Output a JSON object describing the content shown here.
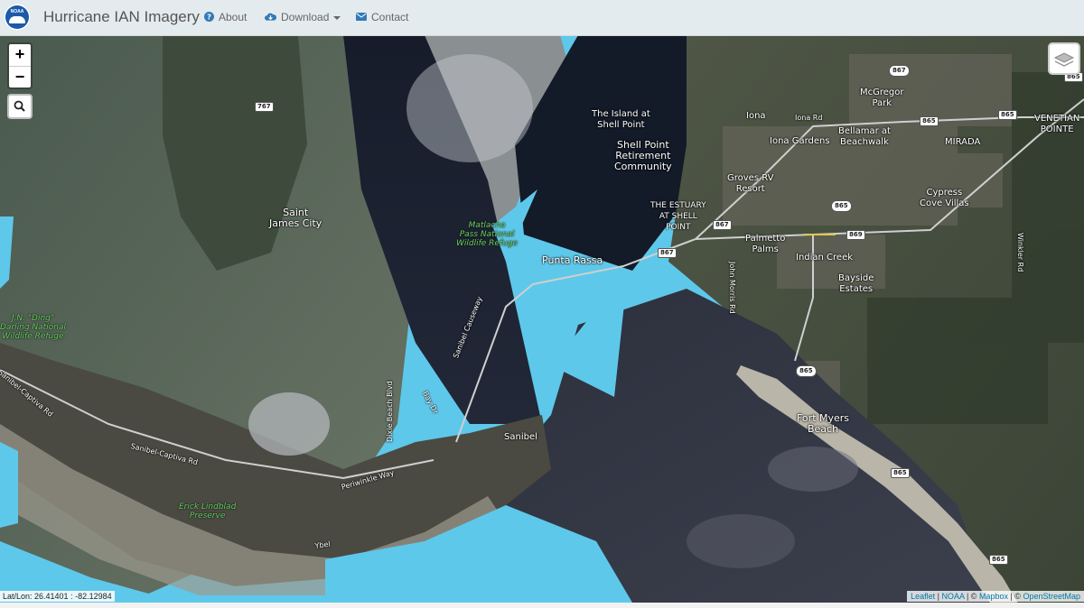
{
  "header": {
    "title": "Hurricane IAN Imagery",
    "logo_text": "NOAA",
    "nav": [
      {
        "label": "About",
        "icon": "question-circle-icon"
      },
      {
        "label": "Download",
        "icon": "cloud-download-icon"
      },
      {
        "label": "Contact",
        "icon": "envelope-icon"
      }
    ]
  },
  "controls": {
    "zoom_in": "+",
    "zoom_out": "−",
    "search_icon": "magnifier-icon",
    "layers_icon": "stacked-layers-icon"
  },
  "status": {
    "latlon": "Lat/Lon: 26.41401 : -82.12984"
  },
  "attribution": {
    "leaflet": "Leaflet",
    "sep1": " | ",
    "noaa": "NOAA",
    "sep2": " | © ",
    "mapbox": "Mapbox",
    "sep3": " | © ",
    "osm": "OpenStreetMap"
  },
  "map": {
    "water_color": "#5ec8ea",
    "places": {
      "saint_james": "Saint\nJames City",
      "punta_rassa": "Punta Rassa",
      "island_shell": "The Island at\nShell Point",
      "shell_retirement": "Shell Point\nRetirement\nCommunity",
      "estuary": "THE ESTUARY\nAT SHELL\nPOINT",
      "iona": "Iona",
      "iona_rd": "Iona Rd",
      "iona_gardens": "Iona Gardens",
      "mcgregor": "McGregor\nPark",
      "bellamar": "Bellamar at\nBeachwalk",
      "miraida": "MIRADA",
      "venetian": "VENETIAN\nPOINTE",
      "groves": "Groves RV\nResort",
      "cypress": "Cypress\nCove Villas",
      "palmetto": "Palmetto\nPalms",
      "indian_creek": "Indian Creek",
      "bayside": "Bayside\nEstates",
      "fort_myers_beach": "Fort Myers\nBeach",
      "sanibel": "Sanibel"
    },
    "parks": {
      "matlacha": "Matlacha\nPass National\nWildlife Refuge",
      "ding": "J.N. \"Ding\"\nDarling National\nWildlife Refuge",
      "lindblad": "Erick Lindblad\nPreserve"
    },
    "roads": {
      "causeway": "Sanibel Causeway",
      "sanibel_captiva": "Sanibel-Captiva Rd",
      "sanibel_captiva2": "Sanibel-Captiva Rd",
      "periwinkle": "Periwinkle Way",
      "dixie": "Dixie Beach Blvd",
      "bay_dr": "Bay Dr",
      "john_morris": "John Morris Rd",
      "winkler": "Winkler Rd",
      "ybel": "Ybel"
    },
    "shields": {
      "s767": "767",
      "s867a": "867",
      "s867b": "867",
      "s867c": "867",
      "s865a": "865",
      "s865b": "865",
      "s865c": "865",
      "s865d": "865",
      "s865e": "865",
      "s865f": "865",
      "s865g": "865",
      "s869": "869"
    }
  }
}
